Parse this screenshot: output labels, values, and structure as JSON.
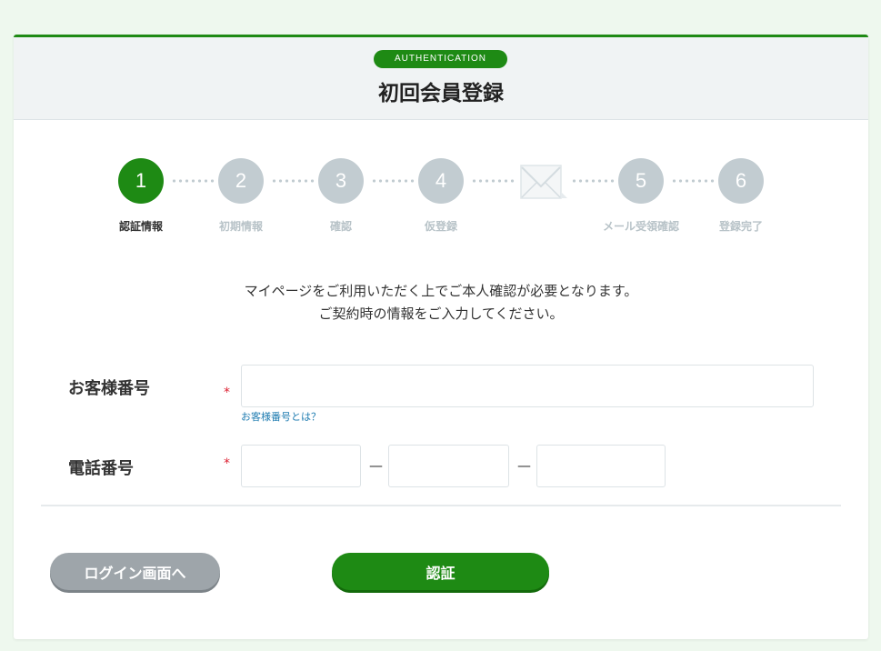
{
  "header": {
    "badge": "AUTHENTICATION",
    "title": "初回会員登録"
  },
  "steps": [
    {
      "number": "1",
      "label": "認証情報",
      "active": true
    },
    {
      "number": "2",
      "label": "初期情報",
      "active": false
    },
    {
      "number": "3",
      "label": "確認",
      "active": false
    },
    {
      "number": "4",
      "label": "仮登録",
      "active": false
    },
    {
      "icon": "mail-icon",
      "label": "",
      "active": false
    },
    {
      "number": "5",
      "label": "メール受領確認",
      "active": false
    },
    {
      "number": "6",
      "label": "登録完了",
      "active": false
    }
  ],
  "intro": {
    "line1": "マイページをご利用いただく上でご本人確認が必要となります。",
    "line2": "ご契約時の情報をご入力してください。"
  },
  "form": {
    "customer_number": {
      "label": "お客様番号",
      "required_mark": "*",
      "value": "",
      "help_link": "お客様番号とは？"
    },
    "phone": {
      "label": "電話番号",
      "required_mark": "*",
      "part1": "",
      "part2": "",
      "part3": "",
      "separator": "—"
    }
  },
  "buttons": {
    "login": "ログイン画面へ",
    "submit": "認証"
  },
  "colors": {
    "accent": "#1e8a14",
    "inactive_step": "#c2ccd1",
    "page_bg": "#eef8ee"
  }
}
